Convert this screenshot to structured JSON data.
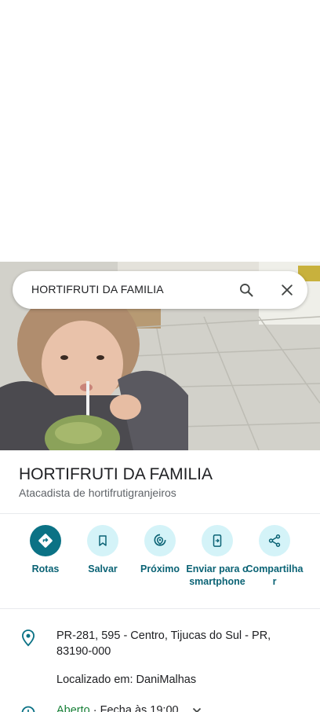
{
  "search": {
    "query": "HORTIFRUTI DA FAMILIA"
  },
  "place": {
    "title": "HORTIFRUTI DA FAMILIA",
    "category": "Atacadista de hortifrutigranjeiros"
  },
  "actions": [
    {
      "label": "Rotas",
      "icon": "directions-icon"
    },
    {
      "label": "Salvar",
      "icon": "bookmark-icon"
    },
    {
      "label": "Próximo",
      "icon": "nearby-icon"
    },
    {
      "label": "Enviar para o smartphone",
      "icon": "send-to-phone-icon"
    },
    {
      "label": "Compartilhar",
      "icon": "share-icon"
    }
  ],
  "details": {
    "address": "PR-281, 595 - Centro, Tijucas do Sul - PR, 83190-000",
    "located_in": "Localizado em: DaniMalhas",
    "hours_status": "Aberto",
    "hours_close": "Fecha às 19:00"
  },
  "colors": {
    "accent": "#0b7285",
    "accent_light": "#d4f3f8",
    "open_green": "#188038"
  }
}
